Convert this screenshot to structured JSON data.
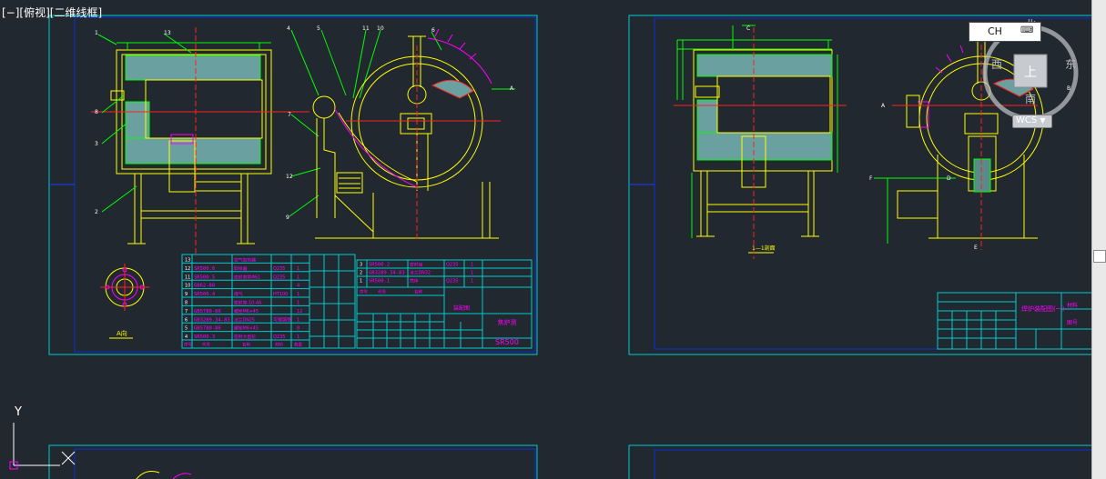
{
  "viewport": {
    "label": "[−][俯视][二维线框]"
  },
  "viewcube": {
    "north": "北",
    "south": "南",
    "east": "东",
    "west": "西",
    "face": "上"
  },
  "wcs": {
    "label": "WCS"
  },
  "ime": {
    "label": "CH"
  },
  "ucs": {
    "y": "Y",
    "x": "X"
  },
  "colors": {
    "background": "#212830",
    "frame": "#00cccc",
    "yellow": "#ffff00",
    "magenta": "#ff00ff",
    "green": "#00ff00",
    "red": "#ff2020",
    "white": "#ffffff",
    "blue": "#1c3cff"
  },
  "sheet1": {
    "leaders": [
      "1",
      "13",
      "4",
      "5",
      "11",
      "10",
      "6",
      "8",
      "3",
      "2",
      "7",
      "12",
      "9",
      "A"
    ],
    "section_label": "A向",
    "bom_rows": [
      {
        "no": "13",
        "code": "",
        "name": "空气加热器",
        "mat": "",
        "qty": ""
      },
      {
        "no": "12",
        "code": "SR500.6",
        "name": "取样器",
        "mat": "Q235",
        "qty": "1"
      },
      {
        "no": "11",
        "code": "SR500.5",
        "name": "密封类管Φ61",
        "mat": "Q235",
        "qty": "1"
      },
      {
        "no": "10",
        "code": "GB62-88",
        "name": "",
        "mat": "",
        "qty": "4"
      },
      {
        "no": "9",
        "code": "SR500.4",
        "name": "煤气",
        "mat": "HT100",
        "qty": "1"
      },
      {
        "no": "8",
        "code": "",
        "name": "密封类-10-4A",
        "mat": "",
        "qty": "1"
      },
      {
        "no": "7",
        "code": "GB5780-86",
        "name": "螺栓M6×45",
        "mat": "",
        "qty": "12"
      },
      {
        "no": "6",
        "code": "GB3289.34-83",
        "name": "法兰DN25",
        "mat": "可锻铸铁",
        "qty": "1"
      },
      {
        "no": "5",
        "code": "GB5780-86",
        "name": "螺栓M6×45",
        "mat": "",
        "qty": "8"
      },
      {
        "no": "4",
        "code": "SR500.3",
        "name": "密封大齿轮",
        "mat": "Q235",
        "qty": "1"
      }
    ],
    "bom_rows_b": [
      {
        "no": "3",
        "code": "SR500.2",
        "name": "密封齿",
        "mat": "Q235",
        "qty": "1"
      },
      {
        "no": "2",
        "code": "GB3289.34-83",
        "name": "法兰DN32",
        "mat": "",
        "qty": "1"
      },
      {
        "no": "1",
        "code": "SR500.1",
        "name": "筒体",
        "mat": "Q235",
        "qty": "1"
      }
    ],
    "bom_header": {
      "no": "序号",
      "code": "代号",
      "name": "名称",
      "mat": "材料",
      "qty": "数量"
    },
    "title_block": {
      "title": "装配图",
      "drawing_no": "SR500",
      "name": "焦炉测"
    }
  },
  "sheet2": {
    "leaders": [
      "C",
      "B",
      "A",
      "F",
      "D",
      "E"
    ],
    "section_label": "1—1剖面",
    "title_block": {
      "title": "焊炉装配图(一)",
      "mat": "材料",
      "sheet": "图号"
    }
  }
}
